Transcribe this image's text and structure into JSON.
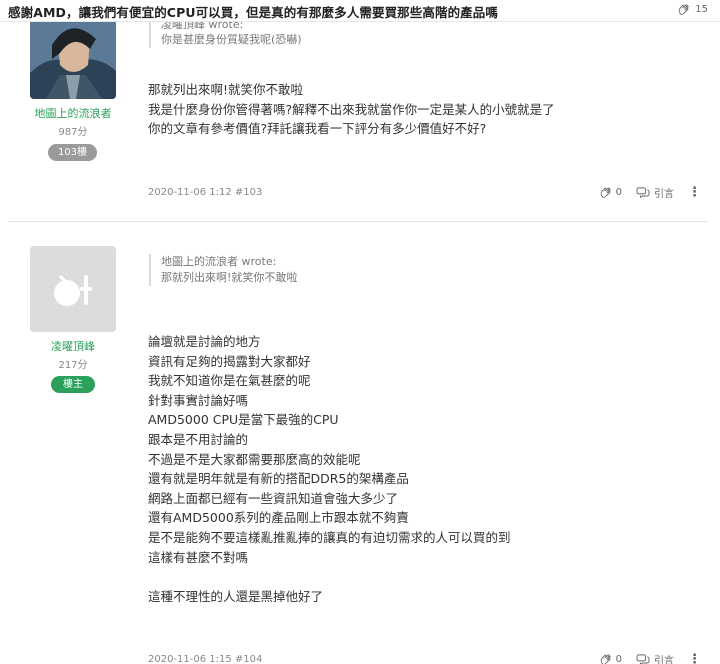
{
  "topbar": {
    "title": "感謝AMD，讓我們有便宜的CPU可以買，但是真的有那麼多人需要買那些高階的產品嗎",
    "like_count": "15",
    "like_icon": "clap-icon"
  },
  "posts": [
    {
      "user": {
        "name": "地圖上的流浪者",
        "score": "987分",
        "badge": "103樓",
        "avatar": "character-avatar"
      },
      "quote": {
        "author_line": "凌曜頂峰 wrote:",
        "text": "你是甚麼身份質疑我呢(恐嚇)"
      },
      "lines": [
        "那就列出來啊!就笑你不敢啦",
        "我是什麼身份你管得著嗎?解釋不出來我就當作你一定是某人的小號就是了",
        "你的文章有參考價值?拜託讓我看一下評分有多少價值好不好?"
      ],
      "meta": {
        "date": "2020-11-06 1:12 #103",
        "likes": "0",
        "reply_label": "引言"
      }
    },
    {
      "user": {
        "name": "凌曜頂峰",
        "score": "217分",
        "badge": "樓主",
        "avatar": "default-avatar"
      },
      "quote": {
        "author_line": "地圖上的流浪者 wrote:",
        "text": "那就列出來啊!就笑你不敢啦"
      },
      "lines": [
        "論壇就是討論的地方",
        "資訊有足夠的揭露對大家都好",
        "我就不知道你是在氣甚麼的呢",
        "針對事實討論好嗎",
        "AMD5000 CPU是當下最強的CPU",
        "跟本是不用討論的",
        "不過是不是大家都需要那麼高的效能呢",
        "還有就是明年就是有新的搭配DDR5的架構產品",
        "網路上面都已經有一些資訊知道會強大多少了",
        "還有AMD5000系列的產品剛上市跟本就不夠賣",
        "是不是能夠不要這樣亂推亂捧的讓真的有迫切需求的人可以買的到",
        "這樣有甚麼不對嗎",
        "",
        "這種不理性的人還是黑掉他好了"
      ],
      "meta": {
        "date": "2020-11-06 1:15 #104",
        "likes": "0",
        "reply_label": "引言"
      }
    }
  ],
  "colors": {
    "accent_green": "#2ba05a",
    "badge_gray": "#9a9a9a"
  }
}
